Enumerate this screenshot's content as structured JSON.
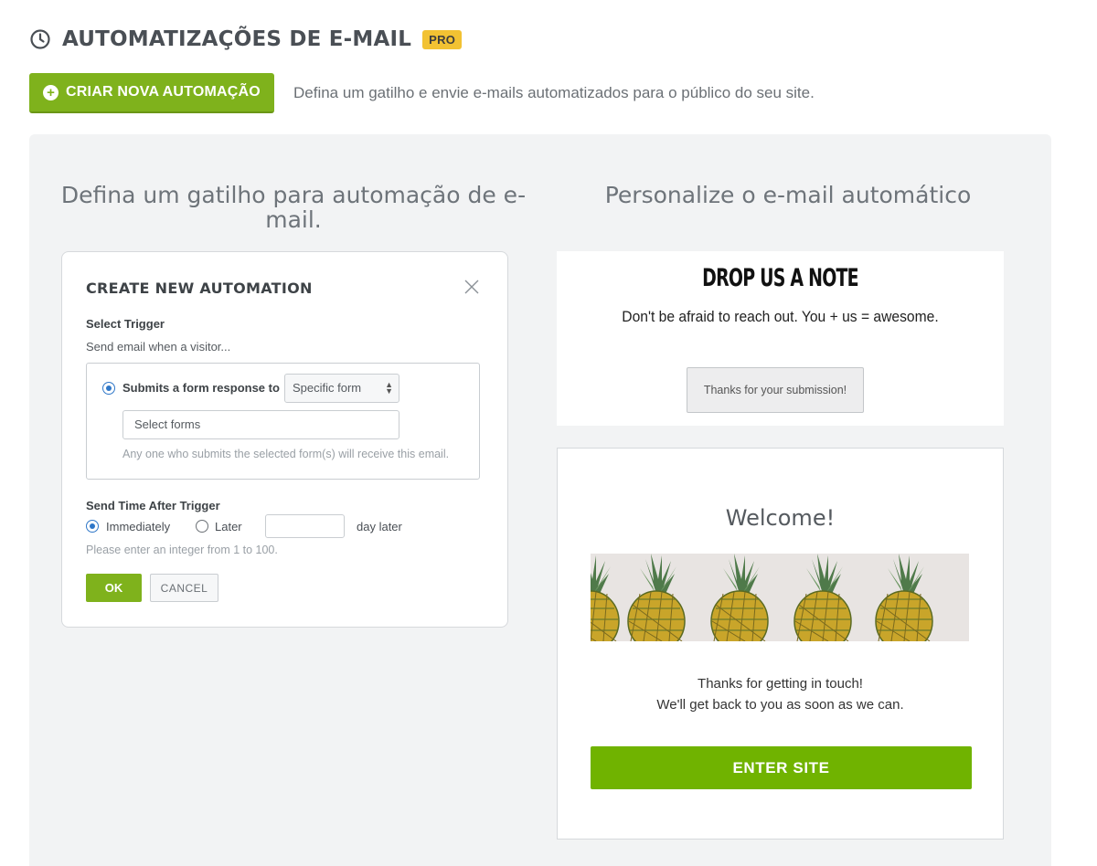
{
  "header": {
    "title": "AUTOMATIZAÇÕES DE E-MAIL",
    "badge": "PRO"
  },
  "toolbar": {
    "create_label": "CRIAR NOVA AUTOMAÇÃO",
    "description": "Defina um gatilho e envie e-mails automatizados para o público do seu site."
  },
  "panel": {
    "left_title": "Defina um gatilho para automação de e-mail.",
    "right_title": "Personalize o e-mail automático"
  },
  "dialog": {
    "title": "CREATE NEW AUTOMATION",
    "select_trigger_label": "Select Trigger",
    "trigger_subtext": "Send email when a visitor...",
    "trigger_option": "Submits a form response to",
    "form_select_value": "Specific form",
    "forms_input_placeholder": "Select forms",
    "forms_hint": "Any one who submits the selected form(s) will receive this email.",
    "send_time_label": "Send Time After Trigger",
    "immediately_label": "Immediately",
    "later_label": "Later",
    "day_later_label": "day later",
    "integer_hint": "Please enter an integer  from 1 to 100.",
    "ok_label": "OK",
    "cancel_label": "CANCEL"
  },
  "note_preview": {
    "title": "DROP US A NOTE",
    "subtitle": "Don't be afraid to reach out. You + us = awesome.",
    "submit_label": "Thanks for your submission!"
  },
  "email_preview": {
    "title": "Welcome!",
    "line1": "Thanks for getting in touch!",
    "line2": "We'll get back to you as soon as we can.",
    "button_label": "ENTER SITE"
  },
  "colors": {
    "accent_green": "#7fb21c",
    "enter_green": "#70b300",
    "pro_yellow": "#f2c233",
    "radio_blue": "#2f77c8"
  },
  "icons": [
    "clock-icon",
    "plus-circle-icon",
    "close-icon",
    "up-down-icon",
    "pineapple-image"
  ]
}
